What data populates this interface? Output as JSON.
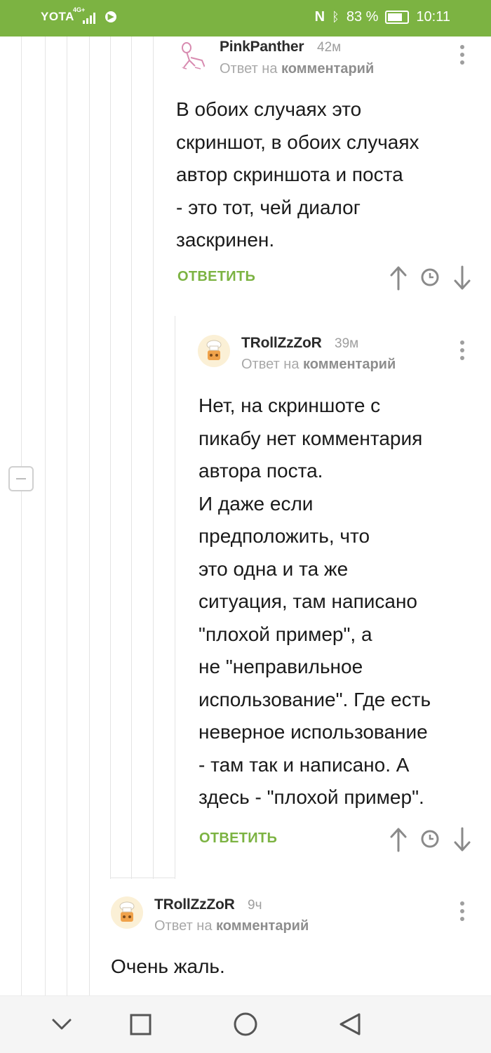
{
  "status_bar": {
    "carrier": "YOTA",
    "network": "4G+",
    "battery": "83 %",
    "time": "10:11"
  },
  "comments": [
    {
      "username": "PinkPanther",
      "time": "42м",
      "reply_prefix": "Ответ на",
      "reply_target": "комментарий",
      "text": "В обоих случаях это\nскриншот, в обоих случаях\nавтор скриншота и поста\n- это тот, чей диалог\nзаскринен.",
      "reply_label": "ОТВЕТИТЬ"
    },
    {
      "username": "TRollZzZoR",
      "time": "39м",
      "reply_prefix": "Ответ на",
      "reply_target": "комментарий",
      "text": "Нет, на скриншоте с\nпикабу нет комментария\nавтора поста.\nИ даже если\nпредположить, что\nэто одна и та же\nситуация, там написано\n\"плохой пример\", а\nне \"неправильное\nиспользование\". Где есть\nневерное использование\n- там так и написано. А\nздесь - \"плохой пример\".",
      "reply_label": "ОТВЕТИТЬ"
    },
    {
      "username": "TRollZzZoR",
      "time": "9ч",
      "reply_prefix": "Ответ на",
      "reply_target": "комментарий",
      "text": "Очень жаль."
    }
  ],
  "icons": {
    "upvote": "arrow-up-icon",
    "history": "clock-icon",
    "downvote": "arrow-down-icon",
    "more": "more-vertical-icon",
    "collapse": "minus-icon"
  },
  "colors": {
    "accent": "#7cb342",
    "muted": "#9e9e9e"
  }
}
